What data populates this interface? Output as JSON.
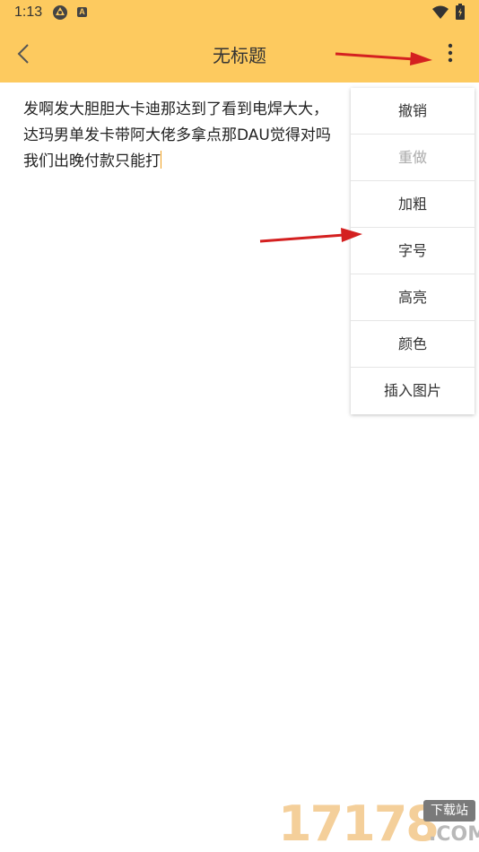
{
  "status_bar": {
    "time": "1:13",
    "icons": [
      "app-notification-icon",
      "a-notification-icon",
      "wifi-icon",
      "battery-icon"
    ],
    "a_badge": "A"
  },
  "toolbar": {
    "title": "无标题",
    "background": "#fdca5f"
  },
  "editor": {
    "lines": [
      "发啊发大胆胆大卡迪那达到了看到电焊大大，",
      "达玛男单发卡带阿大佬多拿点那DAU觉得对吗",
      "我们出晚付款只能打"
    ]
  },
  "menu": {
    "items": [
      {
        "label": "撤销",
        "enabled": true
      },
      {
        "label": "重做",
        "enabled": false
      },
      {
        "label": "加粗",
        "enabled": true
      },
      {
        "label": "字号",
        "enabled": true
      },
      {
        "label": "高亮",
        "enabled": true
      },
      {
        "label": "颜色",
        "enabled": true
      },
      {
        "label": "插入图片",
        "enabled": true
      }
    ]
  },
  "watermark": {
    "digits": "17178",
    "badge": "下载站",
    "suffix": ".COM"
  },
  "colors": {
    "accent": "#fdca5f",
    "annotation_arrow": "#d42020",
    "cursor": "#f0a020"
  }
}
